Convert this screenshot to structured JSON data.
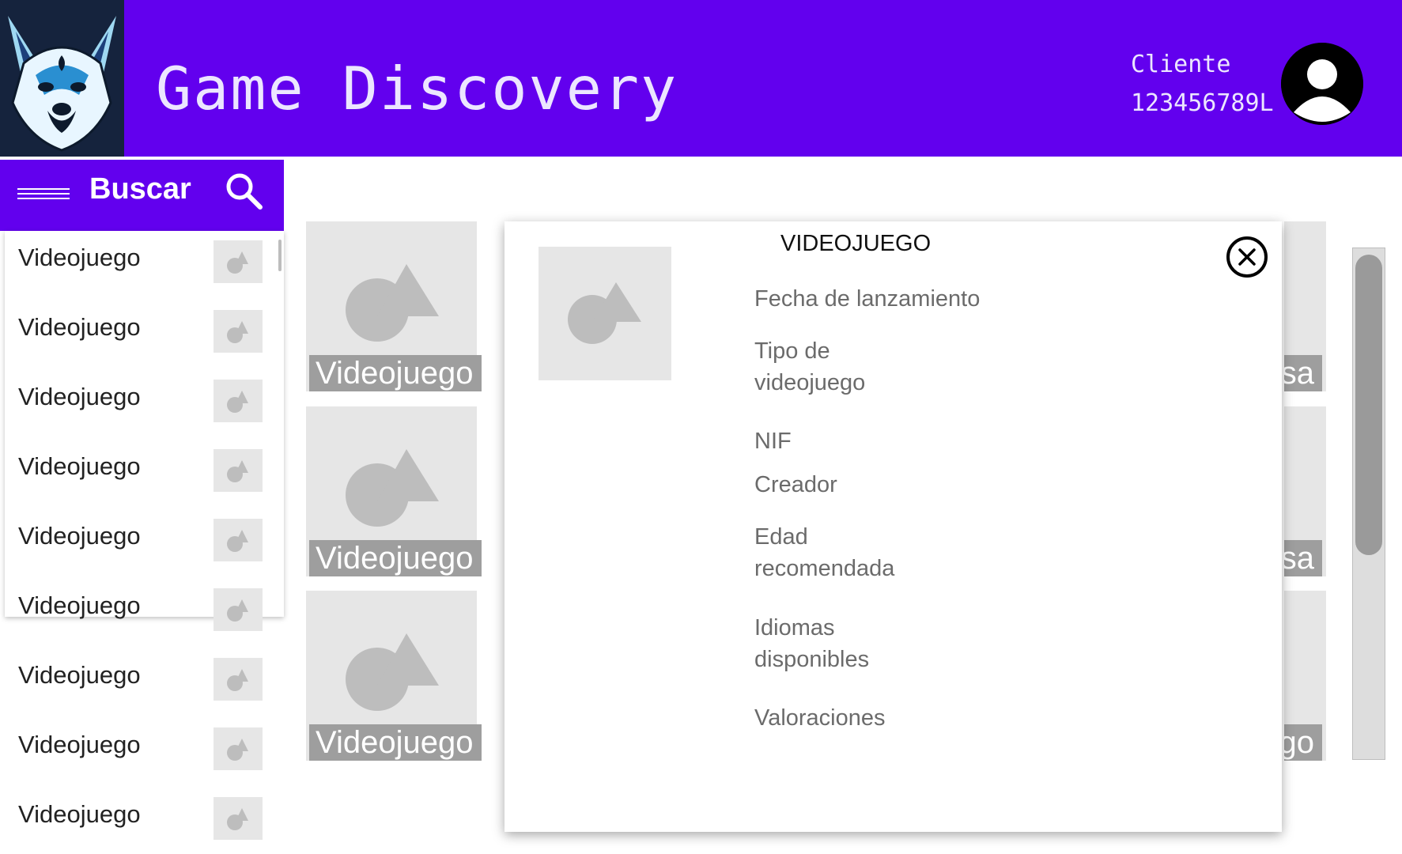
{
  "header": {
    "app_title": "Game Discovery",
    "user_type": "Cliente",
    "user_id": "123456789L",
    "background_color": "#6200ee"
  },
  "search": {
    "label": "Buscar",
    "menu_icon": "menu-icon",
    "search_icon": "search-icon"
  },
  "sidebar": {
    "items": [
      {
        "label": "Videojuego"
      },
      {
        "label": "Videojuego"
      },
      {
        "label": "Videojuego"
      },
      {
        "label": "Videojuego"
      },
      {
        "label": "Videojuego"
      },
      {
        "label": "Videojuego"
      },
      {
        "label": "Videojuego"
      },
      {
        "label": "Videojuego"
      },
      {
        "label": "Videojuego"
      }
    ]
  },
  "grid": {
    "cards": [
      {
        "caption": "Videojuego"
      },
      {
        "caption": "Videojuego"
      },
      {
        "caption": "Videojuego"
      }
    ],
    "right_cards": [
      {
        "caption": "sa"
      },
      {
        "caption": "sa"
      },
      {
        "caption": "ego"
      }
    ]
  },
  "modal": {
    "title": "VIDEOJUEGO",
    "close_icon": "close-icon",
    "fields": [
      "Fecha de lanzamiento",
      "Tipo de videojuego",
      "NIF",
      "Creador",
      "Edad recomendada",
      "Idiomas disponibles",
      "Valoraciones"
    ]
  }
}
